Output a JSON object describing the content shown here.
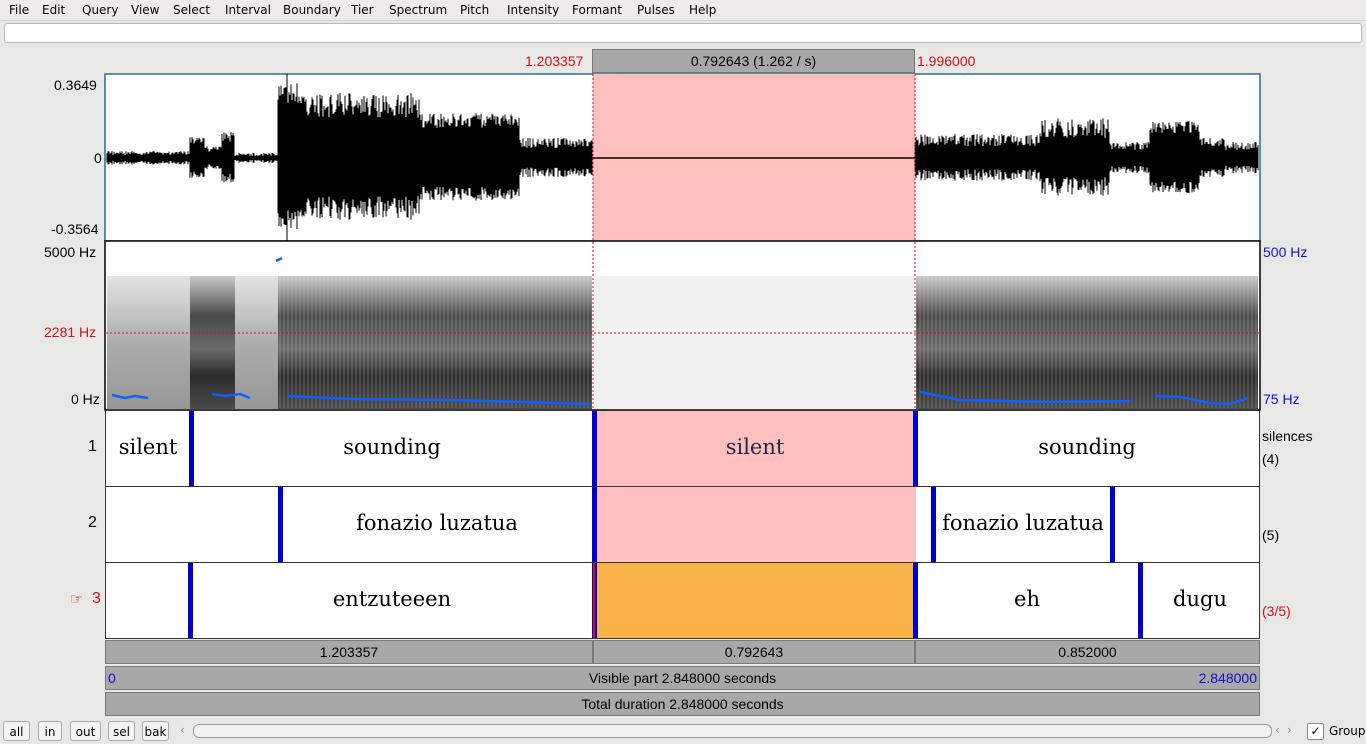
{
  "menu": [
    "File",
    "Edit",
    "Query",
    "View",
    "Select",
    "Interval",
    "Boundary",
    "Tier",
    "Spectrum",
    "Pitch",
    "Intensity",
    "Formant",
    "Pulses",
    "Help"
  ],
  "selection": {
    "start": "1.203357",
    "end": "1.996000",
    "duration_header": "0.792643 (1.262 / s)"
  },
  "waveform": {
    "max": "0.3649",
    "zero": "0",
    "min": "-0.3564"
  },
  "spectrogram": {
    "freq_max": "5000 Hz",
    "freq_cursor": "2281 Hz",
    "freq_min": "0 Hz",
    "pitch_max": "500 Hz",
    "pitch_min": "75 Hz"
  },
  "tiers": [
    {
      "number": "1",
      "name": "silences",
      "count": "(4)",
      "labels": [
        "silent",
        "sounding",
        "silent",
        "sounding"
      ]
    },
    {
      "number": "2",
      "name": "",
      "count": "(5)",
      "labels": [
        "fonazio luzatua",
        "fonazio luzatua"
      ]
    },
    {
      "number": "3",
      "marker": "☞",
      "name": "",
      "count": "(3/5)",
      "labels": [
        "entzuteeen",
        "eh",
        "dugu"
      ]
    }
  ],
  "durations": {
    "left": "1.203357",
    "selected": "0.792643",
    "right": "0.852000"
  },
  "visible": {
    "start": "0",
    "text": "Visible part 2.848000 seconds",
    "end": "2.848000"
  },
  "total": "Total duration 2.848000 seconds",
  "buttons": {
    "all": "all",
    "in": "in",
    "out": "out",
    "sel": "sel",
    "bak": "bak"
  },
  "group_label": "Group",
  "colors": {
    "selection": "#ffbfbf",
    "interval_selected": "#f8b248",
    "boundary": "#0000cc",
    "pitch": "#1060ff"
  }
}
